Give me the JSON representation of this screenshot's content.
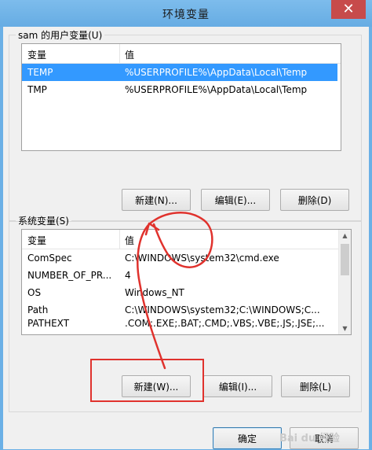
{
  "window": {
    "title": "环境变量",
    "close_glyph": "✕"
  },
  "user_group": {
    "legend": "sam 的用户变量(U)",
    "columns": [
      "变量",
      "值"
    ],
    "rows": [
      {
        "name": "TEMP",
        "value": "%USERPROFILE%\\AppData\\Local\\Temp",
        "selected": true
      },
      {
        "name": "TMP",
        "value": "%USERPROFILE%\\AppData\\Local\\Temp",
        "selected": false
      }
    ],
    "buttons": {
      "new": "新建(N)...",
      "edit": "编辑(E)...",
      "delete": "删除(D)"
    }
  },
  "sys_group": {
    "legend": "系统变量(S)",
    "columns": [
      "变量",
      "值"
    ],
    "rows": [
      {
        "name": "ComSpec",
        "value": "C:\\WINDOWS\\system32\\cmd.exe"
      },
      {
        "name": "NUMBER_OF_PR...",
        "value": "4"
      },
      {
        "name": "OS",
        "value": "Windows_NT"
      },
      {
        "name": "Path",
        "value": "C:\\WINDOWS\\system32;C:\\WINDOWS;C..."
      },
      {
        "name": "PATHEXT",
        "value": ".COM;.EXE;.BAT;.CMD;.VBS;.VBE;.JS;.JSE;..."
      }
    ],
    "buttons": {
      "new": "新建(W)...",
      "edit": "编辑(I)...",
      "delete": "删除(L)"
    }
  },
  "footer": {
    "ok": "确定",
    "cancel": "取消"
  },
  "watermark": "Bai du 经验",
  "colors": {
    "selection": "#3399ff",
    "annotation": "#e0322d",
    "titlebar": "#6bb0e6"
  }
}
